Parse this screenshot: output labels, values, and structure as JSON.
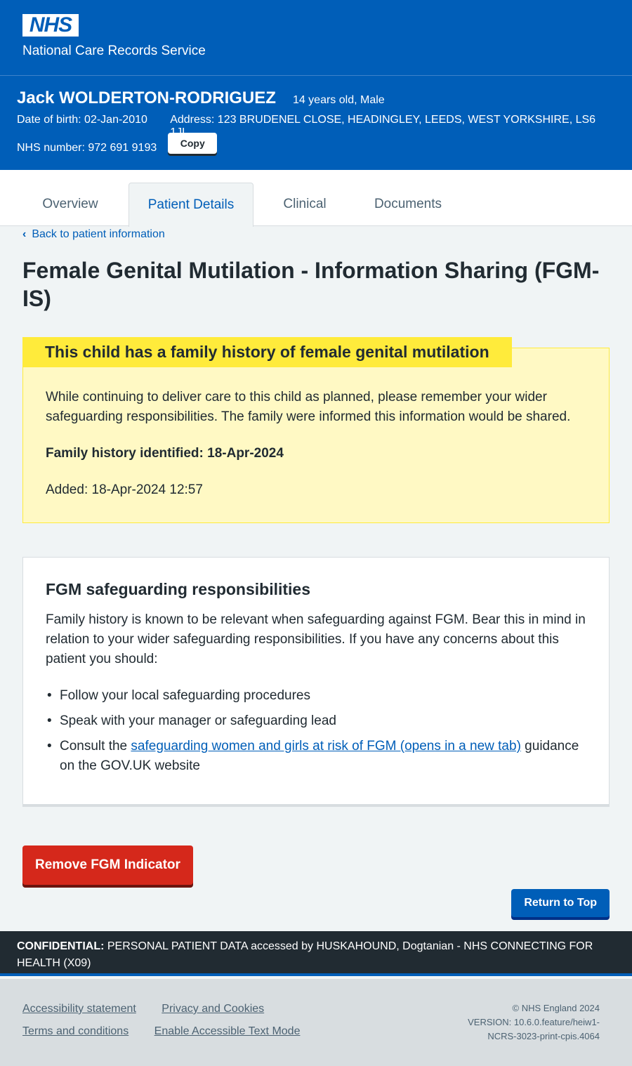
{
  "header": {
    "logo_text": "NHS",
    "service_name": "National Care Records Service"
  },
  "patient": {
    "name": "Jack WOLDERTON-RODRIGUEZ",
    "age_sex": "14 years old, Male",
    "dob": "Date of birth: 02-Jan-2010",
    "address": "Address: 123 BRUDENEL CLOSE, HEADINGLEY, LEEDS, WEST YORKSHIRE, LS6 1JL",
    "nhs_number": "NHS number: 972 691 9193",
    "copy_label": "Copy"
  },
  "tabs": [
    {
      "label": "Overview",
      "active": false
    },
    {
      "label": "Patient Details",
      "active": true
    },
    {
      "label": "Clinical",
      "active": false
    },
    {
      "label": "Documents",
      "active": false
    }
  ],
  "back_link": "Back to patient information",
  "page_title": "Female Genital Mutilation - Information Sharing (FGM-IS)",
  "warning": {
    "heading": "This child has a family history of female genital mutilation",
    "body": "While continuing to deliver care to this child as planned, please remember your wider safeguarding responsibilities. The family were informed this information would be shared.",
    "identified": "Family history identified: 18-Apr-2024",
    "added": "Added: 18-Apr-2024 12:57"
  },
  "card": {
    "heading": "FGM safeguarding responsibilities",
    "body": "Family history is known to be relevant when safeguarding against FGM. Bear this in mind in relation to your wider safeguarding responsibilities. If you have any concerns about this patient you should:",
    "bullets": [
      "Follow your local safeguarding procedures",
      "Speak with your manager or safeguarding lead"
    ],
    "bullet3_prefix": "Consult the ",
    "bullet3_link": "safeguarding women and girls at risk of FGM (opens in a new tab)",
    "bullet3_suffix": " guidance on the GOV.UK website"
  },
  "actions": {
    "remove": "Remove FGM Indicator",
    "return_top": "Return to Top"
  },
  "confidential": {
    "label": "CONFIDENTIAL:",
    "text": " PERSONAL PATIENT DATA accessed by HUSKAHOUND, Dogtanian - NHS CONNECTING FOR HEALTH (X09)"
  },
  "footer": {
    "links": [
      "Accessibility statement",
      "Privacy and Cookies",
      "Terms and conditions",
      "Enable Accessible Text Mode"
    ],
    "copyright": "© NHS England 2024",
    "version": "VERSION: 10.6.0.feature/heiw1-NCRS-3023-print-cpis.4064"
  },
  "colors": {
    "nhs_blue": "#005eb8",
    "warning_yellow": "#ffeb3b",
    "danger_red": "#d5281b"
  }
}
